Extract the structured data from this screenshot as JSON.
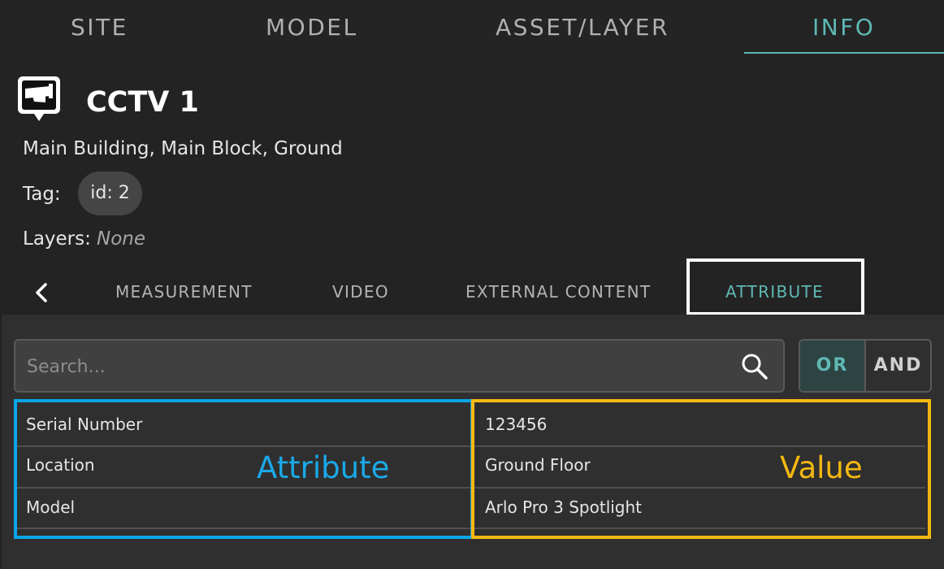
{
  "top_tabs": [
    {
      "label": "SITE",
      "active": false
    },
    {
      "label": "MODEL",
      "active": false
    },
    {
      "label": "ASSET/LAYER",
      "active": false
    },
    {
      "label": "INFO",
      "active": true
    }
  ],
  "asset": {
    "icon": "cctv-camera-icon",
    "title": "CCTV 1",
    "location": "Main Building, Main Block, Ground",
    "tag_label": "Tag:",
    "tag_value": "id: 2",
    "layers_label": "Layers:",
    "layers_value": "None"
  },
  "sub_tabs": [
    {
      "label": "MEASUREMENT",
      "active": false
    },
    {
      "label": "VIDEO",
      "active": false
    },
    {
      "label": "EXTERNAL CONTENT",
      "active": false
    },
    {
      "label": "ATTRIBUTE",
      "active": true
    }
  ],
  "search": {
    "placeholder": "Search...",
    "value": ""
  },
  "logic_toggle": {
    "or_label": "OR",
    "and_label": "AND",
    "selected": "OR"
  },
  "attributes": [
    {
      "name": "Serial Number",
      "value": "123456"
    },
    {
      "name": "Location",
      "value": "Ground Floor"
    },
    {
      "name": "Model",
      "value": "Arlo Pro 3 Spotlight"
    }
  ],
  "annotations": {
    "attribute_label": "Attribute",
    "value_label": "Value"
  },
  "colors": {
    "accent": "#5fb8b5",
    "attribute_highlight": "#0aa5e6",
    "value_highlight": "#f4b810",
    "background": "#232323",
    "panel": "#2f2f2f"
  }
}
